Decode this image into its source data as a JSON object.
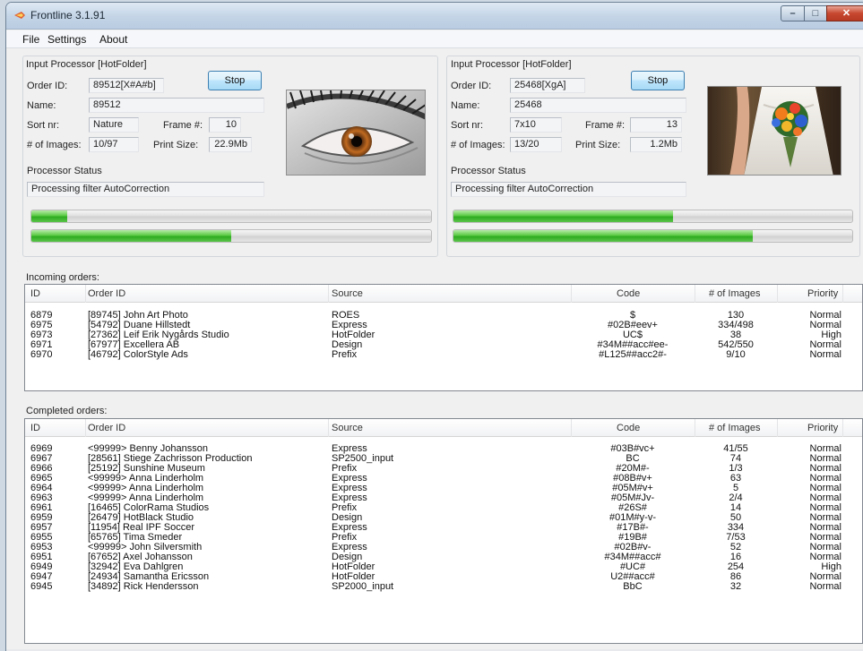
{
  "window": {
    "title": "Frontline 3.1.91"
  },
  "menu": [
    {
      "label": "File"
    },
    {
      "label": "Settings"
    },
    {
      "label": "About"
    }
  ],
  "processors": [
    {
      "title": "Input Processor [HotFolder]",
      "order_id_label": "Order ID:",
      "order_id": "89512[X#A#b]",
      "stop_label": "Stop",
      "name_label": "Name:",
      "name": "89512",
      "sort_label": "Sort nr:",
      "sort": "Nature",
      "frame_label": "Frame #:",
      "frame": "10",
      "images_label": "# of Images:",
      "images": "10/97",
      "printsize_label": "Print Size:",
      "printsize": "22.9Mb",
      "status_label": "Processor Status",
      "status": "Processing filter AutoCorrection",
      "progress1": 0.09,
      "progress2": 0.5
    },
    {
      "title": "Input Processor [HotFolder]",
      "order_id_label": "Order ID:",
      "order_id": "25468[XgA]",
      "stop_label": "Stop",
      "name_label": "Name:",
      "name": "25468",
      "sort_label": "Sort nr:",
      "sort": "7x10",
      "frame_label": "Frame #:",
      "frame": "13",
      "images_label": "# of Images:",
      "images": "13/20",
      "printsize_label": "Print Size:",
      "printsize": "1.2Mb",
      "status_label": "Processor Status",
      "status": "Processing filter AutoCorrection",
      "progress1": 0.55,
      "progress2": 0.75
    }
  ],
  "columns": [
    {
      "label": "ID"
    },
    {
      "label": "Order ID"
    },
    {
      "label": "Source"
    },
    {
      "label": "Code"
    },
    {
      "label": "# of Images"
    },
    {
      "label": "Priority"
    }
  ],
  "incoming": {
    "label": "Incoming orders:",
    "rows": [
      [
        "6879",
        "[89745] John Art Photo",
        "ROES",
        "$",
        "130",
        "Normal"
      ],
      [
        "6975",
        "[54792] Duane Hillstedt",
        "Express",
        "#02B#eev+",
        "334/498",
        "Normal"
      ],
      [
        "6973",
        "[27362] Leif Erik Nygårds Studio",
        "HotFolder",
        "UC$",
        "38",
        "High"
      ],
      [
        "6971",
        "[67977] Excellera AB",
        "Design",
        "#34M##acc#ee-",
        "542/550",
        "Normal"
      ],
      [
        "6970",
        "[46792] ColorStyle Ads",
        "Prefix",
        "#L125##acc2#-",
        "9/10",
        "Normal"
      ]
    ]
  },
  "completed": {
    "label": "Completed orders:",
    "rows": [
      [
        "6969",
        "<99999> Benny Johansson",
        "Express",
        "#03B#vc+",
        "41/55",
        "Normal"
      ],
      [
        "6967",
        "[28561] Stiege Zachrisson Production",
        "SP2500_input",
        "BC",
        "74",
        "Normal"
      ],
      [
        "6966",
        "[25192] Sunshine Museum",
        "Prefix",
        "#20M#-",
        "1/3",
        "Normal"
      ],
      [
        "6965",
        "<99999> Anna Linderholm",
        "Express",
        "#08B#v+",
        "63",
        "Normal"
      ],
      [
        "6964",
        "<99999> Anna Linderholm",
        "Express",
        "#05M#v+",
        "5",
        "Normal"
      ],
      [
        "6963",
        "<99999> Anna Linderholm",
        "Express",
        "#05M#Jv-",
        "2/4",
        "Normal"
      ],
      [
        "6961",
        "[16465] ColorRama Studios",
        "Prefix",
        "#26S#",
        "14",
        "Normal"
      ],
      [
        "6959",
        "[26479] HotBlack Studio",
        "Design",
        "#01M#y-v-",
        "50",
        "Normal"
      ],
      [
        "6957",
        "[11954] Real IPF Soccer",
        "Express",
        "#17B#-",
        "334",
        "Normal"
      ],
      [
        "6955",
        "[65765] Tima Smeder",
        "Prefix",
        "#19B#",
        "7/53",
        "Normal"
      ],
      [
        "6953",
        "<99999> John Silversmith",
        "Express",
        "#02B#v-",
        "52",
        "Normal"
      ],
      [
        "6951",
        "[67652] Axel Johansson",
        "Design",
        "#34M##acc#",
        "16",
        "Normal"
      ],
      [
        "6949",
        "[32942] Eva Dahlgren",
        "HotFolder",
        "#UC#",
        "254",
        "High"
      ],
      [
        "6947",
        "[24934] Samantha Ericsson",
        "HotFolder",
        "U2##acc#",
        "86",
        "Normal"
      ],
      [
        "6945",
        "[34892] Rick Hendersson",
        "SP2000_input",
        "BbC",
        "32",
        "Normal"
      ]
    ]
  }
}
